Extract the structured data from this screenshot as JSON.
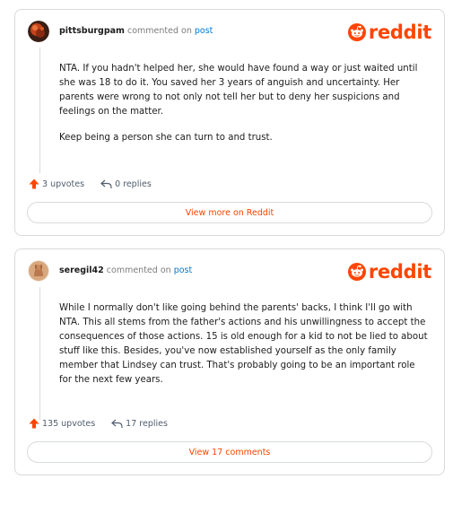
{
  "brand": {
    "wordmark": "reddit",
    "color": "#ff4500"
  },
  "comments": [
    {
      "username": "pittsburgpam",
      "commented_on": "commented on",
      "post_link": "post",
      "paragraphs": [
        "NTA. If you hadn't helped her, she would have found a way or just waited until she was 18 to do it. You saved her 3 years of anguish and uncertainty. Her parents were wrong to not only not tell her but to deny her suspicions and feelings on the matter.",
        "Keep being a person she can turn to and trust."
      ],
      "upvotes": "3 upvotes",
      "replies": "0 replies",
      "view_button": "View more on Reddit"
    },
    {
      "username": "seregil42",
      "commented_on": "commented on",
      "post_link": "post",
      "paragraphs": [
        "While I normally don't like going behind the parents' backs, I think I'll go with NTA. This all stems from the father's actions and his unwillingness to accept the consequences of those actions. 15 is old enough for a kid to not be lied to about stuff like this. Besides, you've now established yourself as the only family member that Lindsey can trust. That's probably going to be an important role for the next few years."
      ],
      "upvotes": "135 upvotes",
      "replies": "17 replies",
      "view_button": "View 17 comments"
    }
  ]
}
